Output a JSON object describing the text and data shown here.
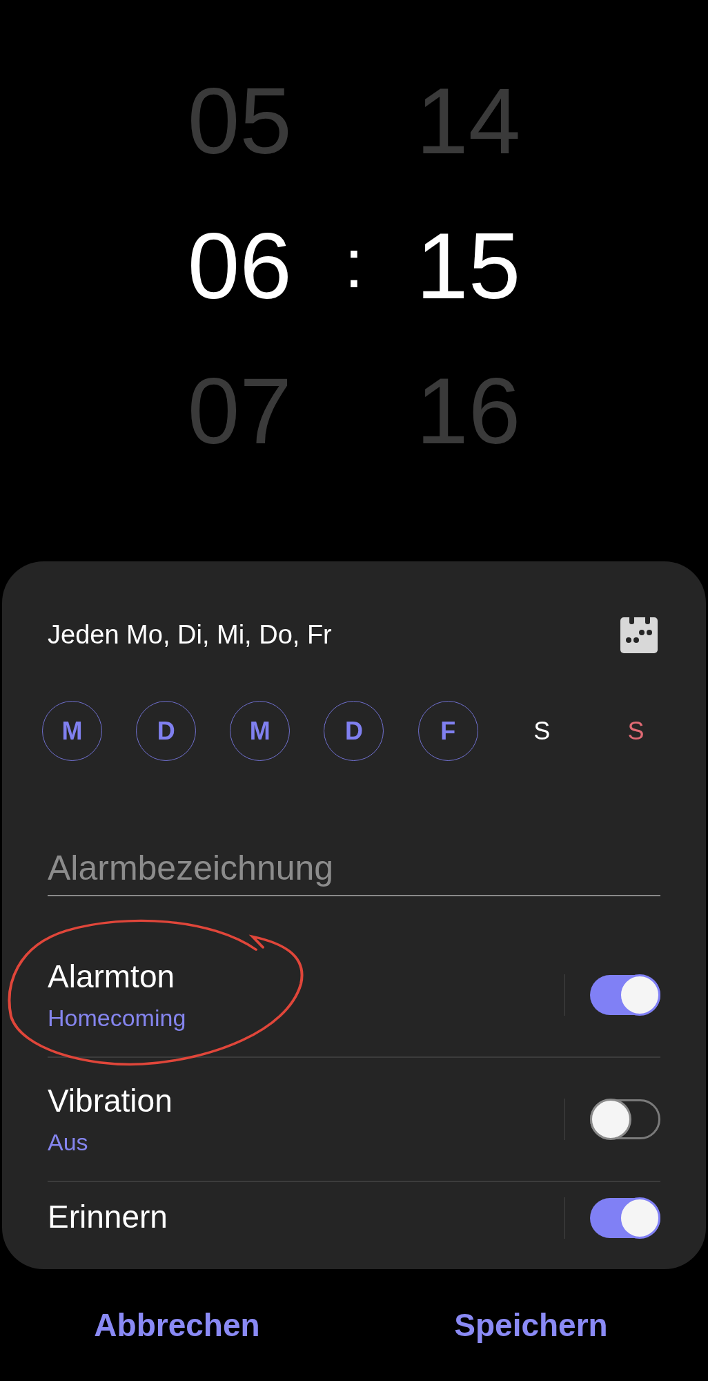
{
  "time_picker": {
    "hours": [
      {
        "value": "05",
        "selected": false
      },
      {
        "value": "06",
        "selected": true
      },
      {
        "value": "07",
        "selected": false
      }
    ],
    "separator": ":",
    "minutes": [
      {
        "value": "14",
        "selected": false
      },
      {
        "value": "15",
        "selected": true
      },
      {
        "value": "16",
        "selected": false
      }
    ]
  },
  "repeat": {
    "summary": "Jeden Mo, Di, Mi, Do, Fr"
  },
  "days": [
    {
      "label": "M",
      "kind": "weekday",
      "selected": true
    },
    {
      "label": "D",
      "kind": "weekday",
      "selected": true
    },
    {
      "label": "M",
      "kind": "weekday",
      "selected": true
    },
    {
      "label": "D",
      "kind": "weekday",
      "selected": true
    },
    {
      "label": "F",
      "kind": "weekday",
      "selected": true
    },
    {
      "label": "S",
      "kind": "weekday",
      "selected": false
    },
    {
      "label": "S",
      "kind": "sunday",
      "selected": false
    }
  ],
  "alarm_name": {
    "placeholder": "Alarmbezeichnung"
  },
  "settings": [
    {
      "title": "Alarmton",
      "value": "Homecoming",
      "on": true
    },
    {
      "title": "Vibration",
      "value": "Aus",
      "on": false
    },
    {
      "title": "Erinnern",
      "on": true
    }
  ],
  "buttons": [
    "Abbrechen",
    "Speichern"
  ]
}
